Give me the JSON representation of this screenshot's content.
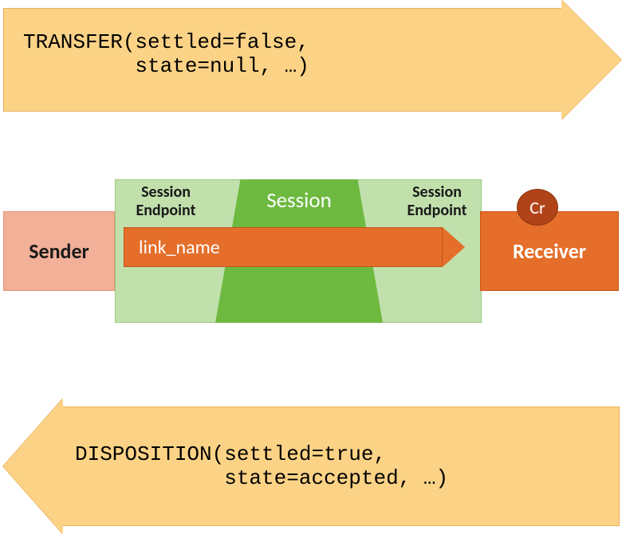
{
  "top_arrow": {
    "line1": "TRANSFER(settled=false,",
    "line2": "         state=null, …)"
  },
  "middle": {
    "sender": "Sender",
    "receiver": "Receiver",
    "session": "Session",
    "session_endpoint_left_l1": "Session",
    "session_endpoint_left_l2": "Endpoint",
    "session_endpoint_right_l1": "Session",
    "session_endpoint_right_l2": "Endpoint",
    "link_name": "link_name",
    "credit": "Cr"
  },
  "bottom_arrow": {
    "line1": "DISPOSITION(settled=true,",
    "line2": "            state=accepted, …)"
  }
}
